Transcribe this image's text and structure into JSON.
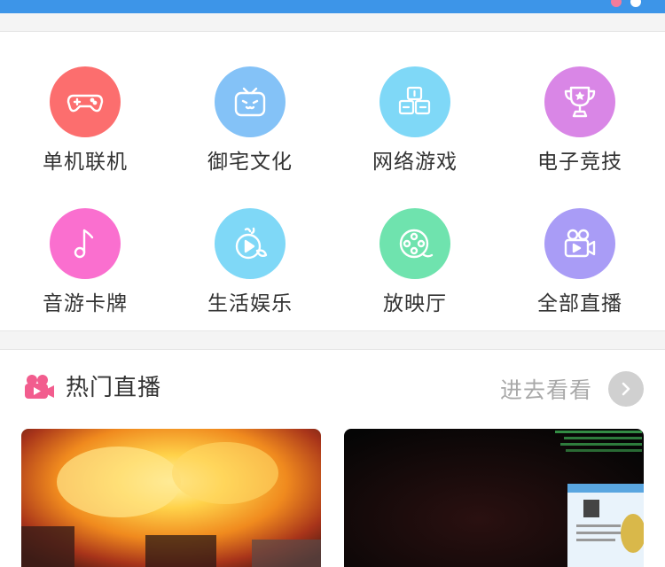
{
  "categories": [
    {
      "label": "单机联机",
      "icon": "gamepad-icon",
      "color": "#fc6e6e"
    },
    {
      "label": "御宅文化",
      "icon": "tv-face-icon",
      "color": "#84c2f7"
    },
    {
      "label": "网络游戏",
      "icon": "keyboard-keys-icon",
      "color": "#7fd8f7"
    },
    {
      "label": "电子竞技",
      "icon": "trophy-icon",
      "color": "#d986e6"
    },
    {
      "label": "音游卡牌",
      "icon": "music-note-icon",
      "color": "#fa6fcf"
    },
    {
      "label": "生活娱乐",
      "icon": "play-leaf-icon",
      "color": "#7fd8f7"
    },
    {
      "label": "放映厅",
      "icon": "film-reel-icon",
      "color": "#6fe3ae"
    },
    {
      "label": "全部直播",
      "icon": "camera-icon",
      "color": "#a99cf6"
    }
  ],
  "hot_live": {
    "title": "热门直播",
    "more_label": "进去看看",
    "icon": "camera-icon",
    "icon_color": "#f25d8e"
  },
  "colors": {
    "top_bar": "#3d95e8",
    "page_indicator_active": "#f27c9b",
    "page_indicator_inactive": "#ffffff"
  }
}
